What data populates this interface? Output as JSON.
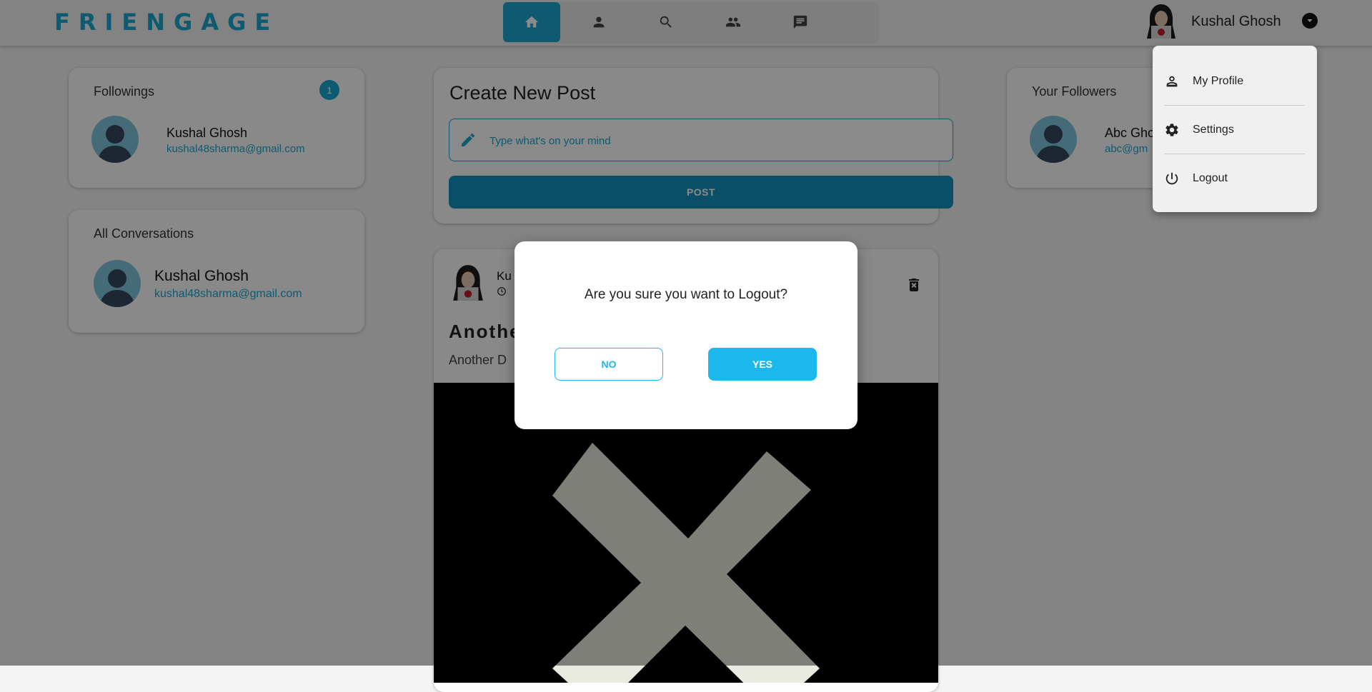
{
  "app": {
    "logo": "FRIENGAGE",
    "accent_color": "#1ba6cf"
  },
  "nav": {
    "items": [
      {
        "icon": "home-icon",
        "active": true
      },
      {
        "icon": "person-icon",
        "active": false
      },
      {
        "icon": "search-icon",
        "active": false
      },
      {
        "icon": "people-icon",
        "active": false
      },
      {
        "icon": "chat-icon",
        "active": false
      }
    ]
  },
  "user": {
    "name": "Kushal Ghosh",
    "avatar_icon": "hacker-avatar-icon"
  },
  "user_menu": {
    "items": [
      {
        "label": "My Profile",
        "icon": "person-outline-icon"
      },
      {
        "label": "Settings",
        "icon": "gear-icon"
      },
      {
        "label": "Logout",
        "icon": "power-icon"
      }
    ]
  },
  "followings": {
    "title": "Followings",
    "count": "1",
    "people": [
      {
        "name": "Kushal Ghosh",
        "email": "kushal48sharma@gmail.com"
      }
    ]
  },
  "conversations": {
    "title": "All Conversations",
    "people": [
      {
        "name": "Kushal Ghosh",
        "email": "kushal48sharma@gmail.com"
      }
    ]
  },
  "create_post": {
    "title": "Create New Post",
    "placeholder": "Type what's on your mind",
    "button": "POST"
  },
  "followers": {
    "title": "Your Followers",
    "people": [
      {
        "name": "Abc Gho",
        "email": "abc@gm"
      }
    ]
  },
  "feed": {
    "posts": [
      {
        "author": "Ku",
        "title": "Anothe",
        "description": "Another D"
      }
    ]
  },
  "logout_dialog": {
    "message": "Are you sure you want to Logout?",
    "no_label": "NO",
    "yes_label": "YES"
  }
}
